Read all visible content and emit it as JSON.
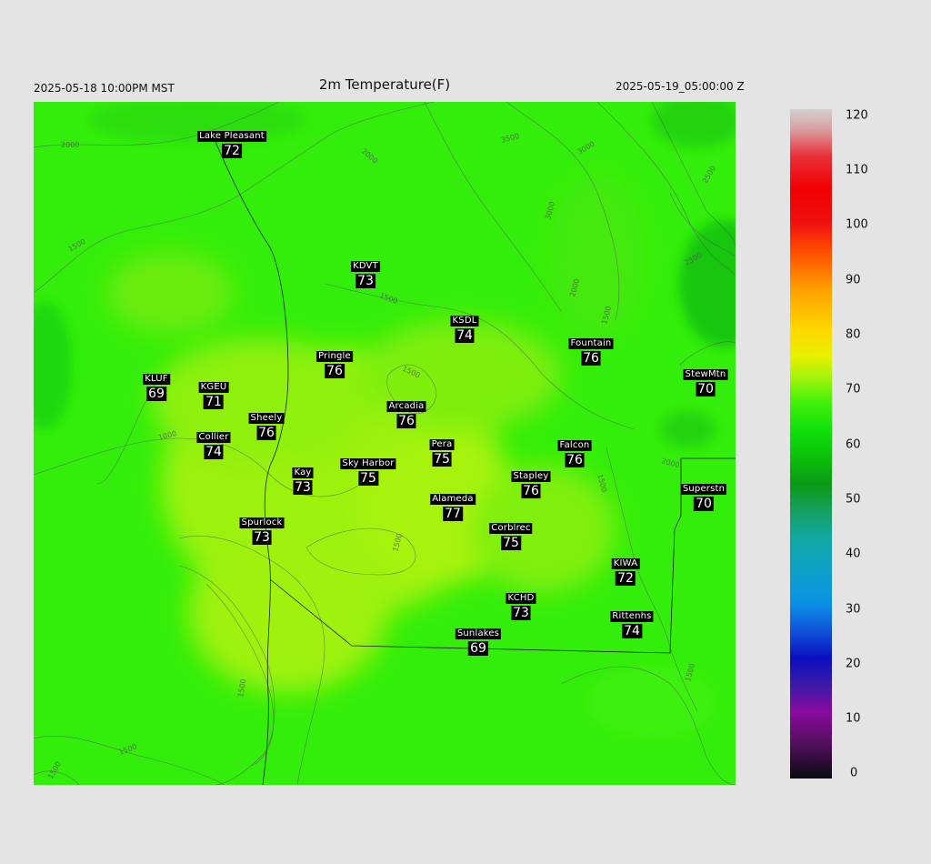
{
  "header": {
    "local_time": "2025-05-18 10:00PM MST",
    "title": "2m Temperature(F)",
    "utc_time": "2025-05-19_05:00:00 Z"
  },
  "stations": [
    {
      "name": "Lake Pleasant",
      "value": "72"
    },
    {
      "name": "KDVT",
      "value": "73"
    },
    {
      "name": "KSDL",
      "value": "74"
    },
    {
      "name": "Fountain",
      "value": "76"
    },
    {
      "name": "StewMtn",
      "value": "70"
    },
    {
      "name": "Pringle",
      "value": "76"
    },
    {
      "name": "KLUF",
      "value": "69"
    },
    {
      "name": "KGEU",
      "value": "71"
    },
    {
      "name": "Arcadia",
      "value": "76"
    },
    {
      "name": "Sheely",
      "value": "76"
    },
    {
      "name": "Collier",
      "value": "74"
    },
    {
      "name": "Pera",
      "value": "75"
    },
    {
      "name": "Falcon",
      "value": "76"
    },
    {
      "name": "Kay",
      "value": "73"
    },
    {
      "name": "Sky Harbor",
      "value": "75"
    },
    {
      "name": "Stapley",
      "value": "76"
    },
    {
      "name": "Superstn",
      "value": "70"
    },
    {
      "name": "Alameda",
      "value": "77"
    },
    {
      "name": "Spurlock",
      "value": "73"
    },
    {
      "name": "Corblrec",
      "value": "75"
    },
    {
      "name": "KIWA",
      "value": "72"
    },
    {
      "name": "KCHD",
      "value": "73"
    },
    {
      "name": "Rittenhs",
      "value": "74"
    },
    {
      "name": "Sunlakes",
      "value": "69"
    }
  ],
  "contour_labels": [
    "2000",
    "2500",
    "3000",
    "3500",
    "2000",
    "3000",
    "2500",
    "1500",
    "1500",
    "2000",
    "1500",
    "1500",
    "1000",
    "1500",
    "2000",
    "1500",
    "1500",
    "1500",
    "1500",
    "1500"
  ],
  "colorbar": {
    "ticks": [
      "120",
      "110",
      "100",
      "90",
      "80",
      "70",
      "60",
      "50",
      "40",
      "30",
      "20",
      "10",
      "0"
    ],
    "min": 0,
    "max": 120
  },
  "colors": {
    "background": "#e4e4e4",
    "map_base": "#33ee0a",
    "warm_patch": "#a6f20a"
  }
}
